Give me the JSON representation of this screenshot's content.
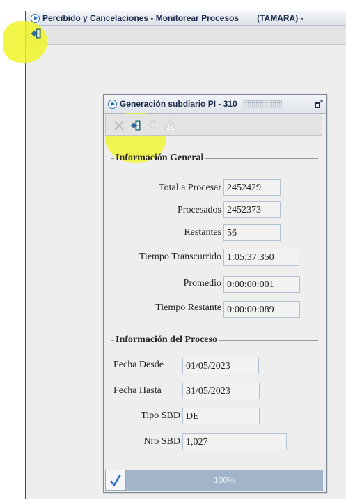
{
  "outer_window": {
    "title": "Percibido y Cancelaciones - Monitorear Procesos",
    "user": "(TAMARA) -"
  },
  "dialog": {
    "title": "Generación subdiario PI - 310",
    "toolbar": {
      "icons": [
        "close-x-icon",
        "exit-door-icon",
        "refresh-icon",
        "warning-icon"
      ]
    },
    "general": {
      "heading": "Información General",
      "rows": [
        {
          "label": "Total a Procesar",
          "value": "2452429"
        },
        {
          "label": "Procesados",
          "value": "2452373"
        },
        {
          "label": "Restantes",
          "value": "56"
        },
        {
          "label": "Tiempo Transcurrido",
          "value": "1:05:37:350"
        },
        {
          "label": "Promedio",
          "value": "0:00:00:001"
        },
        {
          "label": "Tiempo Restante",
          "value": "0:00:00:089"
        }
      ]
    },
    "process": {
      "heading": "Información del Proceso",
      "rows": [
        {
          "label": "Fecha Desde",
          "value": "01/05/2023"
        },
        {
          "label": "Fecha Hasta",
          "value": "31/05/2023"
        },
        {
          "label": "Tipo SBD",
          "value": "DE"
        },
        {
          "label": "Nro SBD",
          "value": "1,027"
        }
      ]
    },
    "status": {
      "progress_percent": 100,
      "progress_label": "100%"
    }
  },
  "colors": {
    "highlight": "#f0f528",
    "progress": "#a6b8cc",
    "accent": "#2e6fbd"
  }
}
